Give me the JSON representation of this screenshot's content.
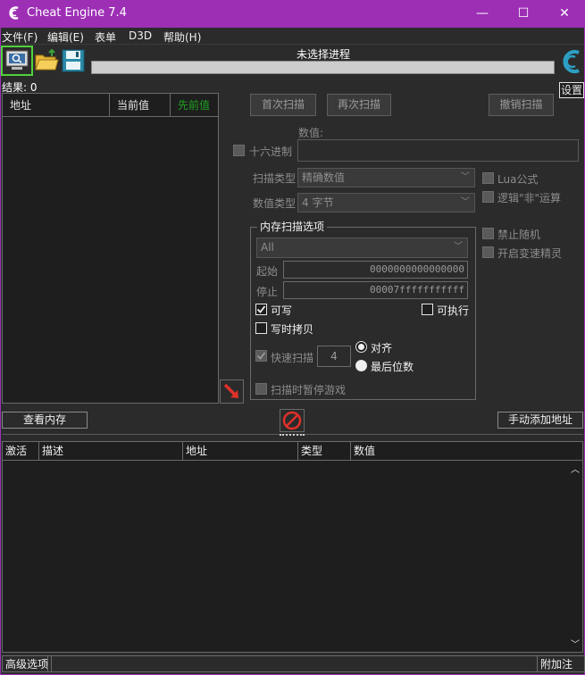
{
  "window": {
    "title": "Cheat Engine 7.4",
    "minimize": "—",
    "maximize": "☐",
    "close": "✕"
  },
  "menu": [
    "文件(F)",
    "编辑(E)",
    "表单",
    "D3D",
    "帮助(H)"
  ],
  "toolbar": {
    "process_title": "未选择进程",
    "settings_label": "设置"
  },
  "results_label": "结果: 0",
  "left_list": {
    "columns": [
      "地址",
      "当前值",
      "先前值"
    ],
    "previous_color": "#1fa21f"
  },
  "scan": {
    "first_scan": "首次扫描",
    "next_scan": "再次扫描",
    "undo_scan": "撤销扫描",
    "value_label": "数值:",
    "hex_label": "十六进制",
    "scan_type_label": "扫描类型",
    "scan_type_value": "精确数值",
    "value_type_label": "数值类型",
    "value_type_value": "4 字节",
    "lua_formula": "Lua公式",
    "not_logic": "逻辑\"非\"运算",
    "disable_random": "禁止随机",
    "speedhack": "开启变速精灵"
  },
  "mem_options": {
    "title": "内存扫描选项",
    "region": "All",
    "start_label": "起始",
    "start_value": "0000000000000000",
    "stop_label": "停止",
    "stop_value": "00007fffffffffff",
    "writable": "可写",
    "executable": "可执行",
    "copy_on_write": "写时拷贝",
    "fast_scan": "快速扫描",
    "fast_scan_value": "4",
    "align": "对齐",
    "last_digits": "最后位数",
    "pause_game": "扫描时暂停游戏"
  },
  "buttons": {
    "view_memory": "查看内存",
    "add_address": "手动添加地址"
  },
  "bottom_table": {
    "columns": [
      "激活",
      "描述",
      "地址",
      "类型",
      "数值"
    ]
  },
  "status": {
    "advanced": "高级选项",
    "comments": "附加注释"
  },
  "colors": {
    "accent": "#9d2fb5",
    "background": "#2b2b2b",
    "list_bg": "#1e1e1e"
  }
}
